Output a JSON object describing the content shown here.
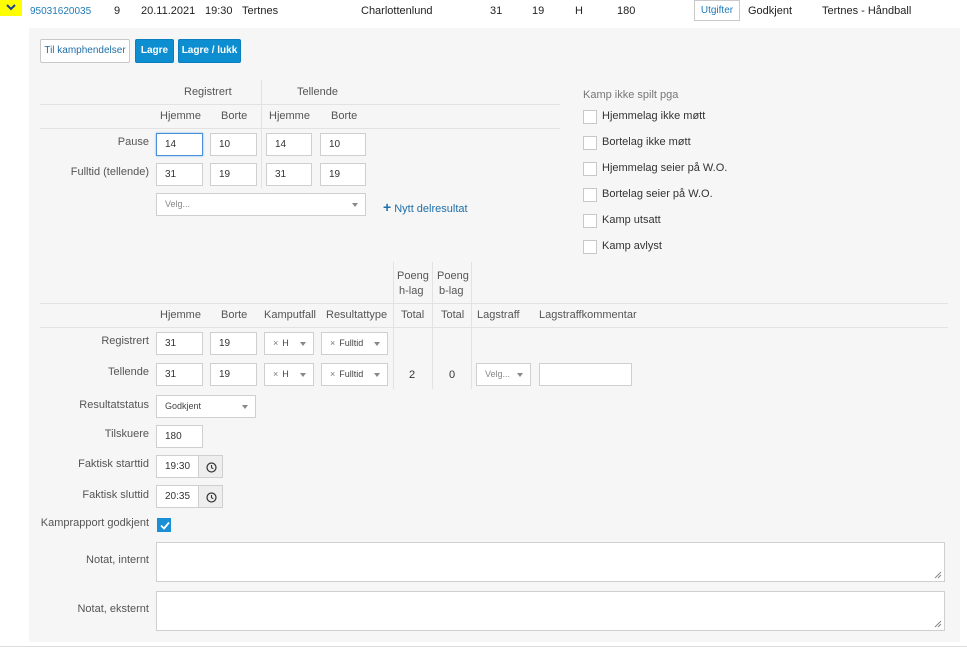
{
  "match_row": {
    "match_no": "95031620035",
    "round": "9",
    "date": "20.11.2021",
    "time": "19:30",
    "home_team": "Tertnes",
    "away_team": "Charlottenlund",
    "home_goals": "31",
    "away_goals": "19",
    "venue_flag": "H",
    "spectators": "180",
    "expenses_button": "Utgifter",
    "status": "Godkjent",
    "tournament": "Tertnes - Håndball"
  },
  "toolbar": {
    "events_label": "Til kamphendelser",
    "save_label": "Lagre",
    "save_close_label": "Lagre / lukk"
  },
  "result_grid": {
    "group_registered": "Registrert",
    "group_counting": "Tellende",
    "col_home": "Hjemme",
    "col_away": "Borte",
    "rows": [
      {
        "label": "Pause",
        "reg_home": "14",
        "reg_away": "10",
        "cnt_home": "14",
        "cnt_away": "10"
      },
      {
        "label": "Fulltid (tellende)",
        "reg_home": "31",
        "reg_away": "19",
        "cnt_home": "31",
        "cnt_away": "19"
      }
    ],
    "partial_select_placeholder": "Velg...",
    "add_partial_label": "Nytt delresultat"
  },
  "not_played": {
    "title": "Kamp ikke spilt pga",
    "options": [
      {
        "label": "Hjemmelag ikke møtt",
        "checked": false
      },
      {
        "label": "Bortelag ikke møtt",
        "checked": false
      },
      {
        "label": "Hjemmelag seier på W.O.",
        "checked": false
      },
      {
        "label": "Bortelag seier på W.O.",
        "checked": false
      },
      {
        "label": "Kamp utsatt",
        "checked": false
      },
      {
        "label": "Kamp avlyst",
        "checked": false
      }
    ]
  },
  "points_grid": {
    "head_points_home_1": "Poeng",
    "head_points_home_2": "h-lag",
    "head_points_away_1": "Poeng",
    "head_points_away_2": "b-lag",
    "col_home": "Hjemme",
    "col_away": "Borte",
    "col_outcome": "Kamputfall",
    "col_result_type": "Resultattype",
    "col_total_home": "Total",
    "col_total_away": "Total",
    "col_team_penalty": "Lagstraff",
    "col_team_penalty_comment": "Lagstraffkommentar",
    "rows": [
      {
        "label": "Registrert",
        "home": "31",
        "away": "19",
        "outcome": "H",
        "result_type": "Fulltid"
      },
      {
        "label": "Tellende",
        "home": "31",
        "away": "19",
        "outcome": "H",
        "result_type": "Fulltid",
        "total_home": "2",
        "total_away": "0",
        "penalty_placeholder": "Velg...",
        "penalty_comment": ""
      }
    ],
    "clear_symbol": "×"
  },
  "details": {
    "result_status_label": "Resultatstatus",
    "result_status_value": "Godkjent",
    "spectators_label": "Tilskuere",
    "spectators_value": "180",
    "start_label": "Faktisk starttid",
    "start_value": "19:30",
    "end_label": "Faktisk sluttid",
    "end_value": "20:35",
    "report_approved_label": "Kamprapport godkjent",
    "report_approved": true,
    "note_internal_label": "Notat, internt",
    "note_internal_value": "",
    "note_external_label": "Notat, eksternt",
    "note_external_value": ""
  },
  "colors": {
    "primary": "#0d8ed1",
    "link": "#1f7ab8",
    "highlight": "#ffff00"
  }
}
